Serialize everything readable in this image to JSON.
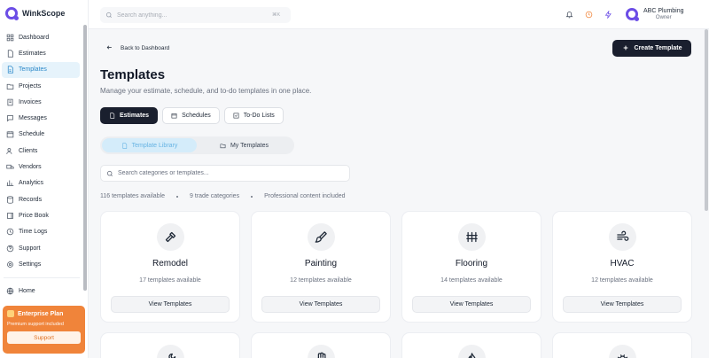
{
  "app": {
    "name": "WinkScope"
  },
  "search": {
    "placeholder": "Search anything...",
    "shortcut": "⌘K"
  },
  "sidebar": {
    "items": [
      {
        "label": "Dashboard",
        "icon": "dashboard-icon"
      },
      {
        "label": "Estimates",
        "icon": "document-icon"
      },
      {
        "label": "Templates",
        "icon": "template-icon"
      },
      {
        "label": "Projects",
        "icon": "folder-icon"
      },
      {
        "label": "Invoices",
        "icon": "invoice-icon"
      },
      {
        "label": "Messages",
        "icon": "message-icon"
      },
      {
        "label": "Schedule",
        "icon": "calendar-icon"
      },
      {
        "label": "Clients",
        "icon": "users-icon"
      },
      {
        "label": "Vendors",
        "icon": "truck-icon"
      },
      {
        "label": "Analytics",
        "icon": "chart-icon"
      },
      {
        "label": "Records",
        "icon": "database-icon"
      },
      {
        "label": "Price Book",
        "icon": "book-icon"
      },
      {
        "label": "Time Logs",
        "icon": "clock-icon"
      },
      {
        "label": "Support",
        "icon": "help-icon"
      },
      {
        "label": "Settings",
        "icon": "gear-icon"
      }
    ],
    "active_index": 2,
    "home": {
      "label": "Home",
      "icon": "globe-icon"
    },
    "plan": {
      "title": "Enterprise Plan",
      "subtitle": "Premium support included",
      "button": "Support"
    }
  },
  "user": {
    "name": "ABC Plumbing",
    "role": "Owner"
  },
  "colors": {
    "accent": "#1a1f2e",
    "brand": "#6b4de6",
    "active_nav": "#2c89c9",
    "plan": "#f0843a"
  },
  "header": {
    "back_label": "Back to Dashboard",
    "create_label": "Create Template",
    "title": "Templates",
    "subtitle": "Manage your estimate, schedule, and to-do templates in one place."
  },
  "tabs": [
    {
      "label": "Estimates",
      "active": true
    },
    {
      "label": "Schedules",
      "active": false
    },
    {
      "label": "To-Do Lists",
      "active": false
    }
  ],
  "segments": [
    {
      "label": "Template Library",
      "active": true
    },
    {
      "label": "My Templates",
      "active": false
    }
  ],
  "category_search": {
    "placeholder": "Search categories or templates..."
  },
  "stats": [
    "116 templates available",
    "9 trade categories",
    "Professional content included"
  ],
  "cards": [
    {
      "title": "Remodel",
      "count": "17 templates available",
      "button": "View Templates",
      "icon": "hammer-icon"
    },
    {
      "title": "Painting",
      "count": "12 templates available",
      "button": "View Templates",
      "icon": "paintbrush-icon"
    },
    {
      "title": "Flooring",
      "count": "14 templates available",
      "button": "View Templates",
      "icon": "fence-icon"
    },
    {
      "title": "HVAC",
      "count": "12 templates available",
      "button": "View Templates",
      "icon": "wind-icon"
    }
  ]
}
